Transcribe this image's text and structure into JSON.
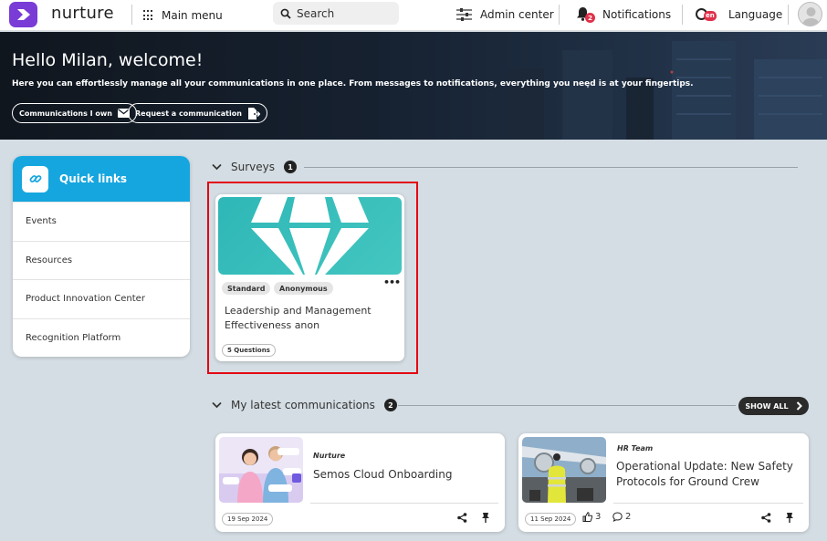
{
  "topbar": {
    "brand": "nurture",
    "main_menu": "Main menu",
    "search_placeholder": "Search",
    "admin_center": "Admin center",
    "notifications": "Notifications",
    "notifications_count": "2",
    "language": "Language",
    "language_code": "en"
  },
  "hero": {
    "title": "Hello Milan, welcome!",
    "subtitle": "Here you can effortlessly manage all your communications in one place. From messages to notifications, everything you need is at your fingertips.",
    "btn_owned": "Communications I own",
    "btn_request": "Request a communication"
  },
  "quick_links": {
    "title": "Quick links",
    "items": [
      {
        "label": "Events"
      },
      {
        "label": "Resources"
      },
      {
        "label": "Product Innovation Center"
      },
      {
        "label": "Recognition Platform"
      }
    ]
  },
  "surveys": {
    "title": "Surveys",
    "count": "1",
    "card": {
      "tags": [
        "Standard",
        "Anonymous"
      ],
      "title": "Leadership and Management Effectiveness anon",
      "questions": "5 Questions"
    }
  },
  "communications": {
    "title": "My latest communications",
    "count": "2",
    "show_all": "SHOW ALL",
    "items": [
      {
        "author": "Nurture",
        "title": "Semos Cloud Onboarding",
        "date": "19 Sep 2024"
      },
      {
        "author": "HR Team",
        "title": "Operational Update: New Safety Protocols for Ground Crew",
        "date": "11 Sep 2024",
        "likes": "3",
        "comments": "2"
      }
    ]
  },
  "colors": {
    "brand_purple": "#7a3cd6",
    "quick_links_blue": "#16a6df",
    "highlight_red": "#e30613",
    "survey_teal": "#2eb7b7"
  }
}
